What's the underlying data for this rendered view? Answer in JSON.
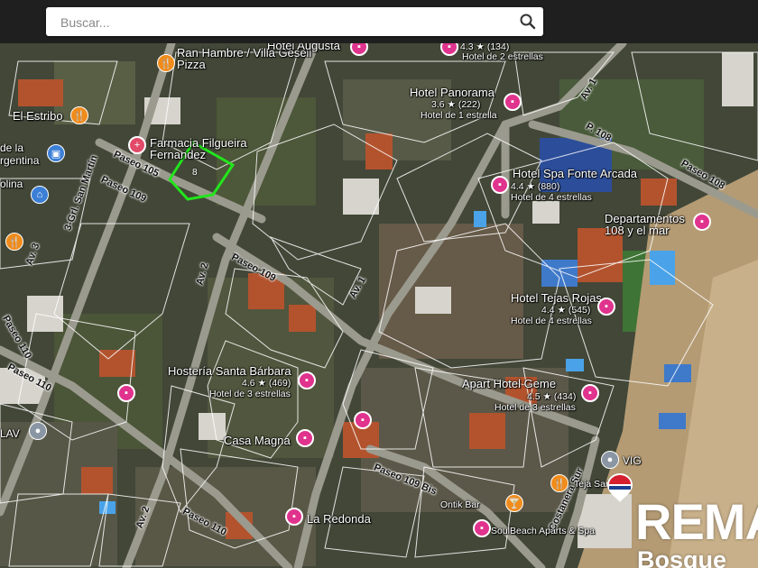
{
  "search": {
    "placeholder": "Buscar..."
  },
  "colors": {
    "parcel_highlight": "#22e51c",
    "hotel_pin": "#e0338d",
    "food_pin": "#f08c1c",
    "road": "#9b9a8e"
  },
  "places": [
    {
      "name": "Ran Hambre / Villa Gesell",
      "line2": "Pizza",
      "type": "food"
    },
    {
      "name": "Hotel Augusta",
      "type": "hotel"
    },
    {
      "name": "Hotel de 2 estrellas",
      "rating": "4.3 ★ (134)",
      "type": "hotel"
    },
    {
      "name": "Hotel Panorama",
      "rating": "3.6 ★ (222)",
      "line2": "Hotel de 1 estrella",
      "type": "hotel"
    },
    {
      "name": "El Estribo",
      "type": "food"
    },
    {
      "name": "Farmacia Filgueira Fernandez",
      "type": "pharmacy"
    },
    {
      "name": "Hotel Spa Fonte Arcada",
      "rating": "4.4 ★ (880)",
      "line2": "Hotel de 4 estrellas",
      "type": "hotel"
    },
    {
      "name": "Departamentos 108 y el mar",
      "type": "hotel"
    },
    {
      "name": "Hotel Tejas Rojas",
      "rating": "4.4 ★ (545)",
      "line2": "Hotel de 4 estrellas",
      "type": "hotel"
    },
    {
      "name": "Hostería Santa Bárbara",
      "rating": "4.6 ★ (469)",
      "line2": "Hotel de 3 estrellas",
      "type": "hotel"
    },
    {
      "name": "Apart Hotel Geme",
      "rating": "4.5 ★ (434)",
      "line2": "Hotel de 3 estrellas",
      "type": "hotel"
    },
    {
      "name": "Casa Magna",
      "type": "hotel"
    },
    {
      "name": "La Redonda",
      "type": "hotel"
    },
    {
      "name": "SoulBeach Aparts & Spa",
      "type": "hotel"
    },
    {
      "name": "Ontik Bar",
      "type": "food"
    },
    {
      "name": "Teja Sangr...",
      "type": "food"
    }
  ],
  "streets": {
    "paseo105": "Paseo 105",
    "paseo109": "Paseo 109",
    "paseo109b": "Paseo 109",
    "paseo110": "Paseo 110",
    "paseo110b": "Paseo 110",
    "paseo110c": "Paseo 110",
    "paseo108": "P. 108",
    "paseo108b": "Paseo 108",
    "av3": "Av. 3",
    "av2": "Av. 2",
    "av2b": "Av. 2",
    "av1": "Av. 1",
    "av1b": "Av. 1",
    "sanmartin": "3-Grl. San Martín",
    "paseo109bis": "Paseo 109 Bis",
    "costanera": "Costanera Sur",
    "partial1": "de la",
    "partial2": "rgentina",
    "partial3": "olina",
    "partial4": "LAV",
    "partial5": "VIG"
  },
  "parcel_label": "8",
  "brand": {
    "name": "REMA",
    "city": "Bosque"
  }
}
